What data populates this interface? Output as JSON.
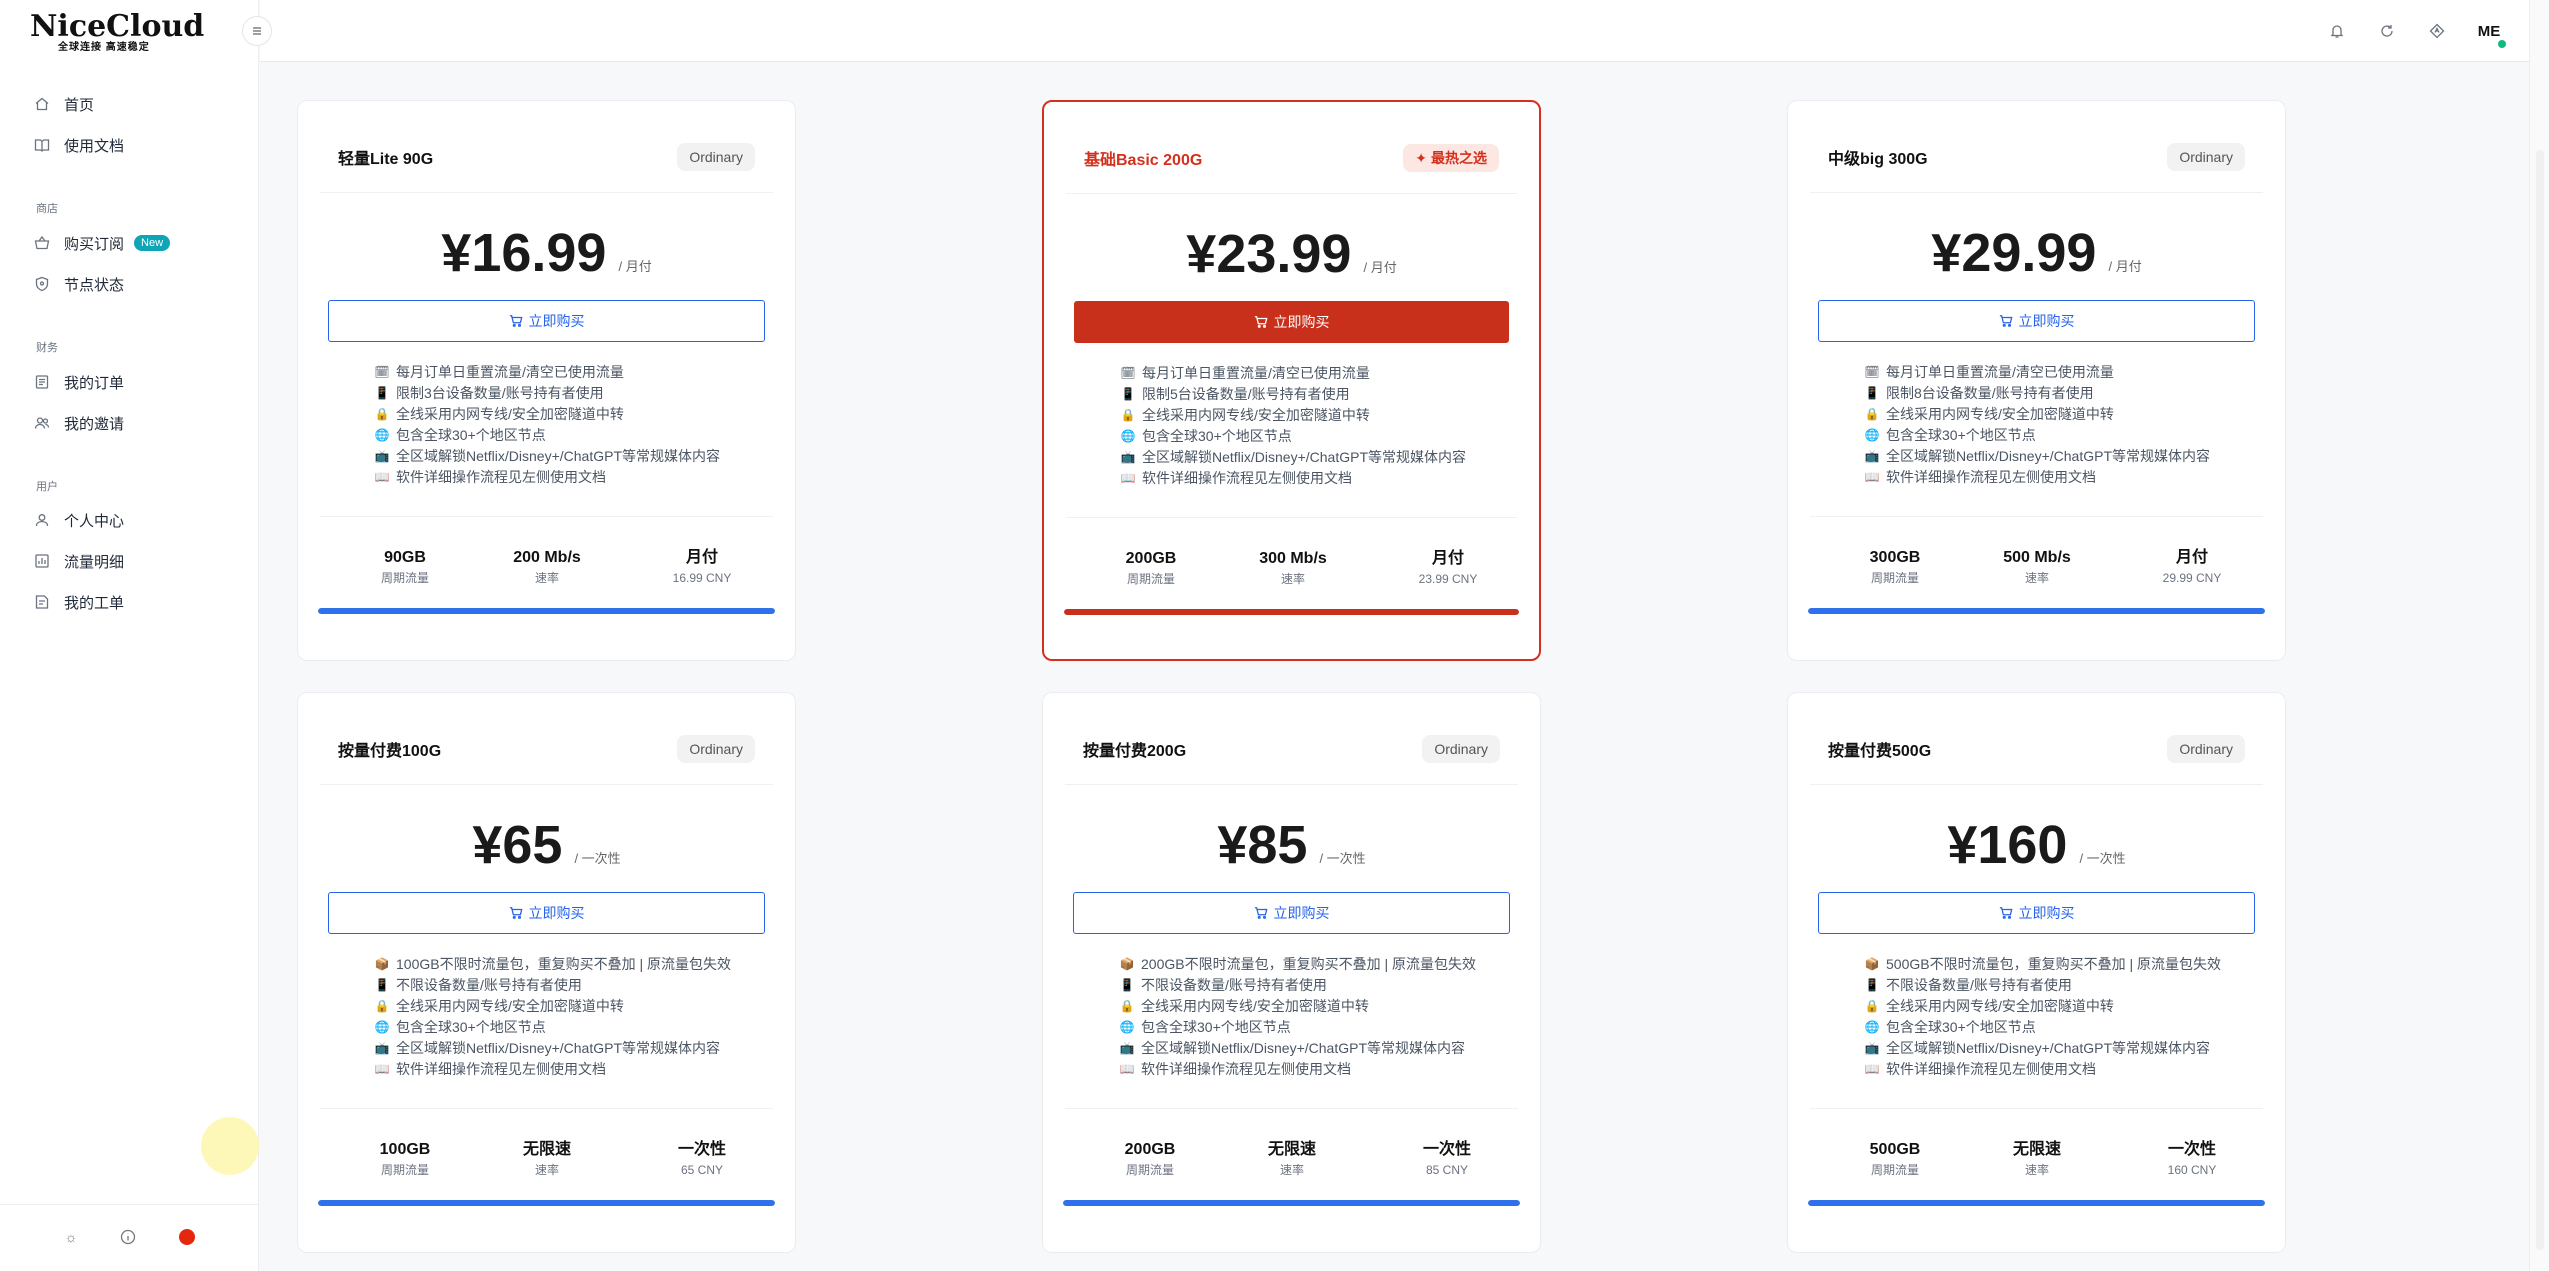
{
  "sidebar": {
    "logo": "NiceCloud",
    "logo_sub": "全球连接 高速稳定",
    "items": [
      {
        "label": "首页",
        "icon": "home-icon"
      },
      {
        "label": "使用文档",
        "icon": "book-icon"
      },
      {
        "label": "购买订阅",
        "icon": "basket-icon",
        "badge": "New"
      },
      {
        "label": "节点状态",
        "icon": "shield-icon"
      },
      {
        "label": "我的订单",
        "icon": "receipt-icon"
      },
      {
        "label": "我的邀请",
        "icon": "users-icon"
      },
      {
        "label": "个人中心",
        "icon": "user-icon"
      },
      {
        "label": "流量明细",
        "icon": "chart-icon"
      },
      {
        "label": "我的工单",
        "icon": "ticket-icon"
      }
    ],
    "sections": {
      "store": "商店",
      "finance": "财务",
      "user": "用户"
    }
  },
  "topbar": {
    "avatar": "ME"
  },
  "cards": [
    {
      "title": "轻量Lite 90G",
      "tag": "Ordinary",
      "hot": false,
      "price": "¥16.99",
      "period": "/ 月付",
      "buy": "立即购买",
      "features": [
        {
          "icon": "calendar",
          "text": "每月订单日重置流量/清空已使用流量"
        },
        {
          "icon": "phone",
          "text": "限制3台设备数量/账号持有者使用"
        },
        {
          "icon": "lock",
          "text": "全线采用内网专线/安全加密隧道中转"
        },
        {
          "icon": "globe",
          "text": "包含全球30+个地区节点"
        },
        {
          "icon": "tv",
          "text": "全区域解锁Netflix/Disney+/ChatGPT等常规媒体内容"
        },
        {
          "icon": "book",
          "text": "软件详细操作流程见左侧使用文档"
        }
      ],
      "stats": [
        {
          "value": "90GB",
          "label": "周期流量"
        },
        {
          "value": "200 Mb/s",
          "label": "速率"
        },
        {
          "value": "月付",
          "label": "16.99 CNY"
        }
      ],
      "progress": 1.0
    },
    {
      "title": "基础Basic 200G",
      "tag": "最热之选",
      "hot": true,
      "price": "¥23.99",
      "period": "/ 月付",
      "buy": "立即购买",
      "features": [
        {
          "icon": "calendar",
          "text": "每月订单日重置流量/清空已使用流量"
        },
        {
          "icon": "phone",
          "text": "限制5台设备数量/账号持有者使用"
        },
        {
          "icon": "lock",
          "text": "全线采用内网专线/安全加密隧道中转"
        },
        {
          "icon": "globe",
          "text": "包含全球30+个地区节点"
        },
        {
          "icon": "tv",
          "text": "全区域解锁Netflix/Disney+/ChatGPT等常规媒体内容"
        },
        {
          "icon": "book",
          "text": "软件详细操作流程见左侧使用文档"
        }
      ],
      "stats": [
        {
          "value": "200GB",
          "label": "周期流量"
        },
        {
          "value": "300 Mb/s",
          "label": "速率"
        },
        {
          "value": "月付",
          "label": "23.99 CNY"
        }
      ],
      "progress": 1.0
    },
    {
      "title": "中级big 300G",
      "tag": "Ordinary",
      "hot": false,
      "price": "¥29.99",
      "period": "/ 月付",
      "buy": "立即购买",
      "features": [
        {
          "icon": "calendar",
          "text": "每月订单日重置流量/清空已使用流量"
        },
        {
          "icon": "phone",
          "text": "限制8台设备数量/账号持有者使用"
        },
        {
          "icon": "lock",
          "text": "全线采用内网专线/安全加密隧道中转"
        },
        {
          "icon": "globe",
          "text": "包含全球30+个地区节点"
        },
        {
          "icon": "tv",
          "text": "全区域解锁Netflix/Disney+/ChatGPT等常规媒体内容"
        },
        {
          "icon": "book",
          "text": "软件详细操作流程见左侧使用文档"
        }
      ],
      "stats": [
        {
          "value": "300GB",
          "label": "周期流量"
        },
        {
          "value": "500 Mb/s",
          "label": "速率"
        },
        {
          "value": "月付",
          "label": "29.99 CNY"
        }
      ],
      "progress": 1.0
    },
    {
      "title": "按量付费100G",
      "tag": "Ordinary",
      "hot": false,
      "price": "¥65",
      "period": "/ 一次性",
      "buy": "立即购买",
      "features": [
        {
          "icon": "package",
          "text": "100GB不限时流量包，重复购买不叠加 | 原流量包失效"
        },
        {
          "icon": "phone",
          "text": "不限设备数量/账号持有者使用"
        },
        {
          "icon": "lock",
          "text": "全线采用内网专线/安全加密隧道中转"
        },
        {
          "icon": "globe",
          "text": "包含全球30+个地区节点"
        },
        {
          "icon": "tv",
          "text": "全区域解锁Netflix/Disney+/ChatGPT等常规媒体内容"
        },
        {
          "icon": "book",
          "text": "软件详细操作流程见左侧使用文档"
        }
      ],
      "stats": [
        {
          "value": "100GB",
          "label": "周期流量"
        },
        {
          "value": "无限速",
          "label": "速率"
        },
        {
          "value": "一次性",
          "label": "65 CNY"
        }
      ],
      "progress": 1.0
    },
    {
      "title": "按量付费200G",
      "tag": "Ordinary",
      "hot": false,
      "price": "¥85",
      "period": "/ 一次性",
      "buy": "立即购买",
      "features": [
        {
          "icon": "package",
          "text": "200GB不限时流量包，重复购买不叠加 | 原流量包失效"
        },
        {
          "icon": "phone",
          "text": "不限设备数量/账号持有者使用"
        },
        {
          "icon": "lock",
          "text": "全线采用内网专线/安全加密隧道中转"
        },
        {
          "icon": "globe",
          "text": "包含全球30+个地区节点"
        },
        {
          "icon": "tv",
          "text": "全区域解锁Netflix/Disney+/ChatGPT等常规媒体内容"
        },
        {
          "icon": "book",
          "text": "软件详细操作流程见左侧使用文档"
        }
      ],
      "stats": [
        {
          "value": "200GB",
          "label": "周期流量"
        },
        {
          "value": "无限速",
          "label": "速率"
        },
        {
          "value": "一次性",
          "label": "85 CNY"
        }
      ],
      "progress": 1.0
    },
    {
      "title": "按量付费500G",
      "tag": "Ordinary",
      "hot": false,
      "price": "¥160",
      "period": "/ 一次性",
      "buy": "立即购买",
      "features": [
        {
          "icon": "package",
          "text": "500GB不限时流量包，重复购买不叠加 | 原流量包失效"
        },
        {
          "icon": "phone",
          "text": "不限设备数量/账号持有者使用"
        },
        {
          "icon": "lock",
          "text": "全线采用内网专线/安全加密隧道中转"
        },
        {
          "icon": "globe",
          "text": "包含全球30+个地区节点"
        },
        {
          "icon": "tv",
          "text": "全区域解锁Netflix/Disney+/ChatGPT等常规媒体内容"
        },
        {
          "icon": "book",
          "text": "软件详细操作流程见左侧使用文档"
        }
      ],
      "stats": [
        {
          "value": "500GB",
          "label": "周期流量"
        },
        {
          "value": "无限速",
          "label": "速率"
        },
        {
          "value": "一次性",
          "label": "160 CNY"
        }
      ],
      "progress": 1.0
    }
  ],
  "colors": {
    "accent": "#2563eb",
    "hot": "#c9301b",
    "progress": "#2f71ea",
    "badge_new": "#0ea5b7"
  }
}
